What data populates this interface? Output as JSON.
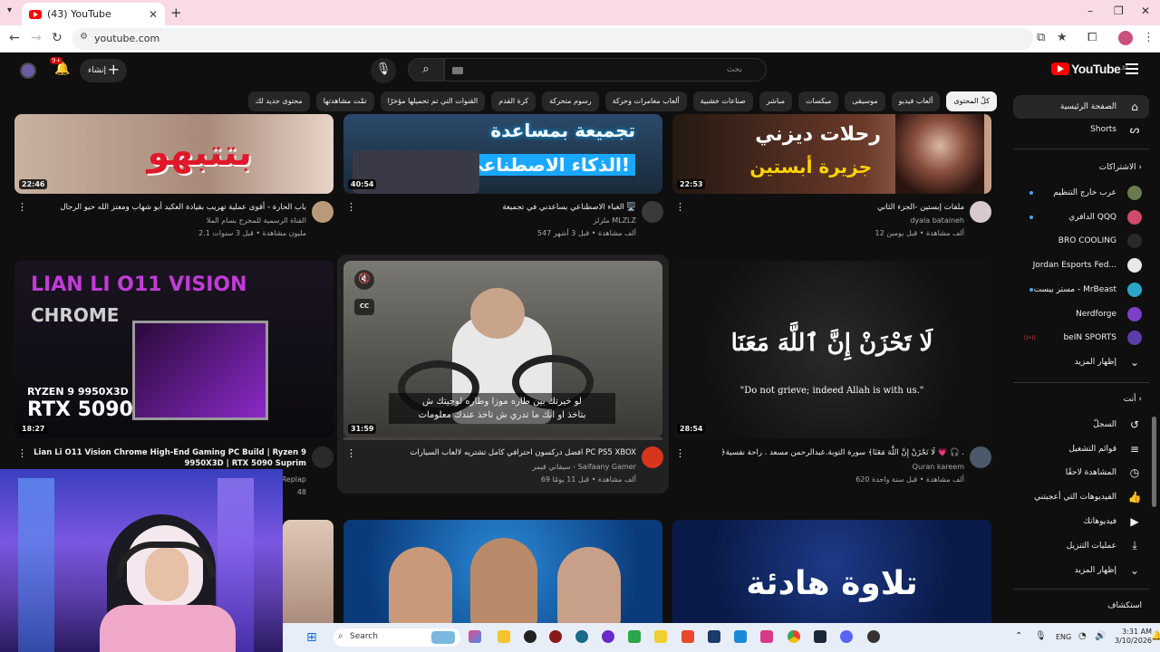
{
  "browser": {
    "tab_title": "(43) YouTube",
    "url": "youtube.com"
  },
  "header": {
    "search_placeholder": "بحث",
    "create_label": "إنشاء",
    "notif_count": "9+",
    "logo_text": "YouTube",
    "logo_region": "JO"
  },
  "chips": [
    "كلّ المحتوى",
    "ألعاب فيديو",
    "موسيقى",
    "ميكسات",
    "مباشر",
    "صناعات خشبية",
    "ألعاب مغامرات وحركة",
    "رسوم متحركة",
    "كرة القدم",
    "القنوات التي تم تحميلها مؤخرًا",
    "تمّت مشاهدتها",
    "محتوى جديد لك"
  ],
  "sidebar": {
    "home": "الصفحة الرئيسية",
    "shorts": "Shorts",
    "subs_heading": "الاشتراكات",
    "subs": [
      {
        "name": "عرب خارج التنظيم",
        "color": "#6b7a4e",
        "dot": true
      },
      {
        "name": "الدافري QQQ",
        "color": "#d04a6a",
        "dot": true
      },
      {
        "name": "BRO COOLING",
        "color": "#2a2a2a",
        "dot": false
      },
      {
        "name": "Jordan Esports Fed...",
        "color": "#e8e8e8",
        "dot": false
      },
      {
        "name": "مستر بيست - MrBeast",
        "color": "#2aa8c8",
        "dot": true
      },
      {
        "name": "Nerdforge",
        "color": "#7b3fc8",
        "dot": false
      },
      {
        "name": "beIN SPORTS",
        "color": "#5a3ea8",
        "live": true
      }
    ],
    "show_more": "إظهار المزيد",
    "you_heading": "أنت",
    "you_items": [
      {
        "label": "السجلّ",
        "icon": "↺"
      },
      {
        "label": "قوائم التشغيل",
        "icon": "≡"
      },
      {
        "label": "المشاهدة لاحقًا",
        "icon": "◷"
      },
      {
        "label": "الفيديوهات التي أعجبتني",
        "icon": "👍"
      },
      {
        "label": "فيديوهاتك",
        "icon": "▶"
      },
      {
        "label": "عمليات التنزيل",
        "icon": "⤓"
      }
    ],
    "show_more2": "إظهار المزيد",
    "explore_heading": "استكشاف"
  },
  "videos_row1": [
    {
      "title": "ملفات إبستين -الجزء الثاني",
      "channel": "dyala bataineh",
      "meta": "12 ألف مشاهدة • قبل يومين",
      "duration": "22:53",
      "thumb_text1": "رحلات ديزني",
      "thumb_text2": "جزيرة أبستين"
    },
    {
      "title": "الغباء الاصطناعي يساعدني في تجميعة 🖥️",
      "channel": "ملزلز MLZLZ",
      "meta": "547 ألف مشاهدة • قبل 3 أشهر",
      "duration": "40:54",
      "thumb_text1": "تجميعة بمساعدة",
      "thumb_text2": "الذكاء الاصطناعي!"
    },
    {
      "title": "باب الحارة - أقوى عملية تهريب بقيادة العكيد أبو شهاب ومعتز الله حيو الرجال",
      "channel": "القناة الرسمية للمخرج بسام الملا",
      "meta": "2.1 مليون مشاهدة • قبل 3 سنوات",
      "duration": "22:46",
      "thumb_text1": "بتتبهو"
    }
  ],
  "videos_row2": [
    {
      "title": "﴿لَا تَحْزَنْ إِنَّ اللَّهَ مَعَنَا﴾ سورة التوبة.عبدالرحمن مسعد . راحة نفسية 💗 🎧 .",
      "channel": "Quran kareem",
      "meta": "620 ألف مشاهدة • قبل سنة واحدة",
      "duration": "28:54",
      "thumb_ar": "لَا تَحْزَنْ إِنَّ ٱللَّهَ مَعَنَا",
      "thumb_en": "\"Do not grieve; indeed Allah is with us.\""
    },
    {
      "title": "افضل دركسون احترافي كامل تشتريه لالعاب السيارات PC PS5 XBOX",
      "channel": "سيفاني قيمر - Saifaany Gamer",
      "meta": "69 ألف مشاهدة • قبل 11 يومًا",
      "duration": "31:59",
      "subtitle1": "لو خيرتك بين طاره موزا وطاره لوجيتك ش",
      "subtitle2": "بتاخذ او انك ما تدري ش تاخذ عندك معلومات"
    },
    {
      "title": "Lian Li O11 Vision Chrome High-End Gaming PC Build | Ryzen 9 9950X3D | RTX 5090 Suprim",
      "channel": "Replap",
      "meta": "48",
      "duration": "18:27",
      "thumb_line1": "LIAN LI O11 VISION",
      "thumb_line2": "CHROME",
      "thumb_line3": "RYZEN 9 9950X3D",
      "thumb_line4": "RTX 5090"
    }
  ],
  "videos_row3": [
    {
      "thumb_text": "تلاوة هادئة"
    }
  ],
  "taskbar": {
    "search_label": "Search",
    "lang": "ENG",
    "time": "3:31 AM",
    "date": "3/10/2026"
  }
}
